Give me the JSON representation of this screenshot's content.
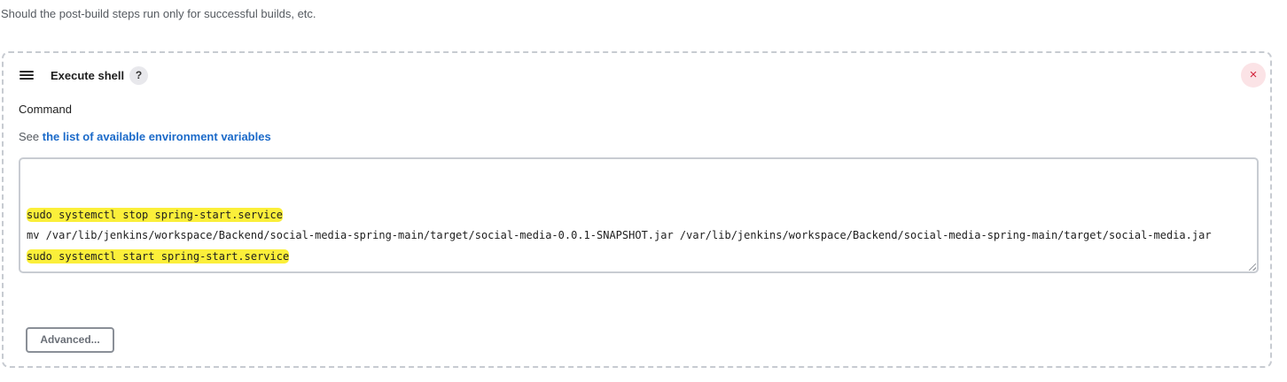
{
  "section": {
    "help_text": "Should the post-build steps run only for successful builds, etc."
  },
  "build_step": {
    "title": "Execute shell",
    "help_badge": "?",
    "close_symbol": "×",
    "field_label": "Command",
    "see_prefix": "See",
    "env_link_text": "the list of available environment variables",
    "command_lines": [
      "sudo systemctl stop spring-start.service",
      "mv /var/lib/jenkins/workspace/Backend/social-media-spring-main/target/social-media-0.0.1-SNAPSHOT.jar /var/lib/jenkins/workspace/Backend/social-media-spring-main/target/social-media.jar",
      "sudo systemctl start spring-start.service"
    ],
    "advanced_label": "Advanced..."
  },
  "icons": {
    "drag_handle": "hamburger-icon",
    "close": "close-icon",
    "help": "help-icon"
  },
  "colors": {
    "link": "#1b6ac9",
    "close_bg": "#fbe3e6",
    "close_fg": "#d2213a",
    "highlight": "#fbef3a"
  }
}
